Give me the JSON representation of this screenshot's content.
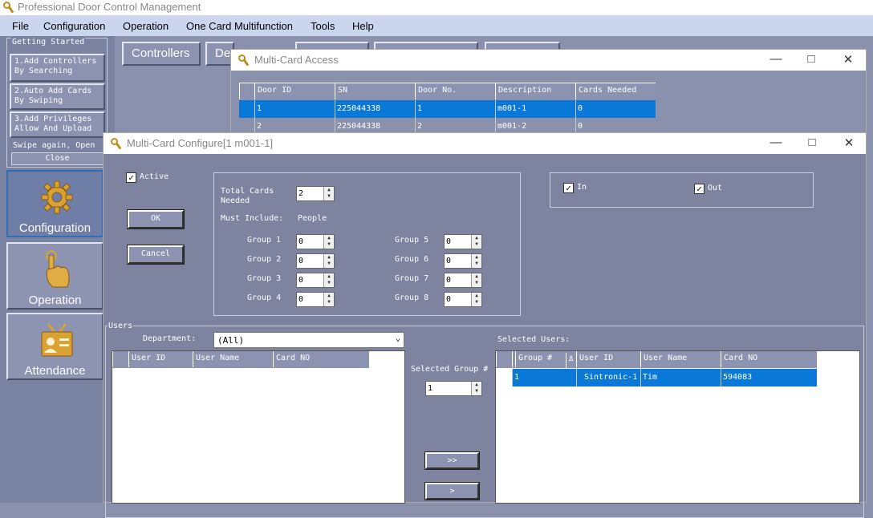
{
  "app": {
    "title": "Professional Door Control Management",
    "menu": [
      "File",
      "Configuration",
      "Operation",
      "One Card Multifunction",
      "Tools",
      "Help"
    ]
  },
  "getting_started": {
    "legend": "Getting Started",
    "steps": [
      {
        "line1": "1.Add Controllers",
        "line2": "By Searching"
      },
      {
        "line1": "2.Auto Add Cards",
        "line2": "By Swiping"
      },
      {
        "line1": "3.Add Privileges",
        "line2": "Allow And Upload"
      }
    ],
    "swipe_text": "Swipe again, Open",
    "close_label": "Close"
  },
  "side_nav": [
    {
      "label": "Configuration",
      "icon": "gear-icon"
    },
    {
      "label": "Operation",
      "icon": "pointing-hand-icon"
    },
    {
      "label": "Attendance",
      "icon": "id-badge-icon"
    }
  ],
  "tabs": [
    "Controllers",
    "De"
  ],
  "multi_card_access": {
    "title": "Multi-Card Access",
    "columns": [
      "Door ID",
      "SN",
      "Door No.",
      "Description",
      "Cards Needed"
    ],
    "rows": [
      {
        "door_id": "1",
        "sn": "225044338",
        "door_no": "1",
        "description": "m001-1",
        "cards_needed": "0"
      },
      {
        "door_id": "2",
        "sn": "225044338",
        "door_no": "2",
        "description": "m001-2",
        "cards_needed": "0"
      }
    ]
  },
  "configure": {
    "title": "Multi-Card Configure[1   m001-1]",
    "active_label": "Active",
    "active_checked": true,
    "ok_label": "OK",
    "cancel_label": "Cancel",
    "total_cards_label_1": "Total Cards",
    "total_cards_label_2": "Needed",
    "total_cards_value": "2",
    "must_include_label": "Must Include:",
    "people_label": "People",
    "groups": [
      {
        "label": "Group 1",
        "value": "0"
      },
      {
        "label": "Group 2",
        "value": "0"
      },
      {
        "label": "Group 3",
        "value": "0"
      },
      {
        "label": "Group 4",
        "value": "0"
      },
      {
        "label": "Group 5",
        "value": "0"
      },
      {
        "label": "Group 6",
        "value": "0"
      },
      {
        "label": "Group 7",
        "value": "0"
      },
      {
        "label": "Group 8",
        "value": "0"
      }
    ],
    "in_label": "In",
    "out_label": "Out",
    "in_checked": true,
    "out_checked": true,
    "users_legend": "Users",
    "department_label": "Department:",
    "department_value": "(All)",
    "users_columns": [
      "User ID",
      "User Name",
      "Card NO"
    ],
    "selected_group_label": "Selected Group #",
    "selected_group_value": "1",
    "add_all_label": ">>",
    "add_one_label": ">",
    "selected_users_label": "Selected Users:",
    "selected_columns": [
      "Group #",
      "User ID",
      "User Name",
      "Card NO"
    ],
    "selected_rows": [
      {
        "group": "1",
        "user_id": "Sintronic-1",
        "user_name": "Tim",
        "card_no": "594083"
      }
    ]
  }
}
